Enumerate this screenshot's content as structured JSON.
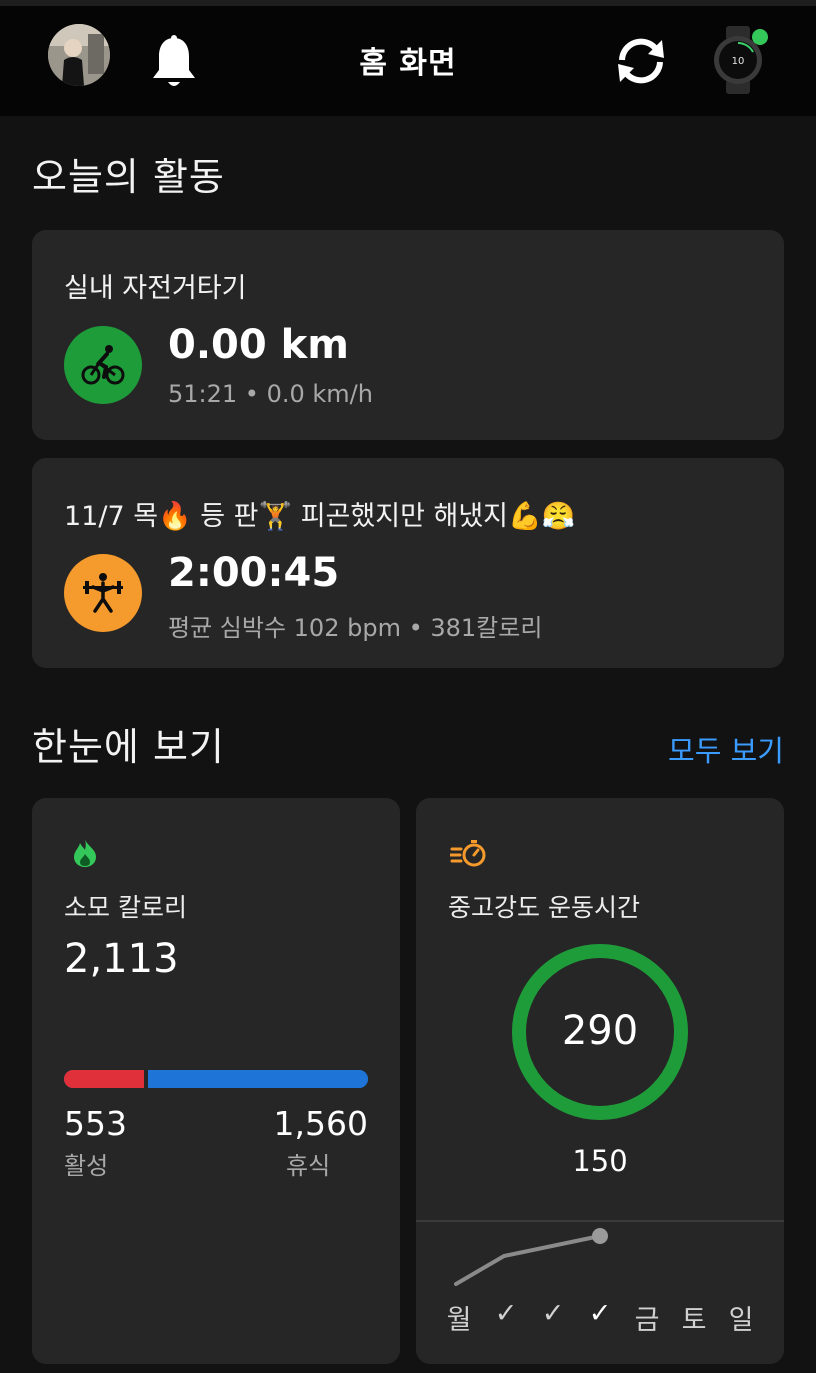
{
  "header": {
    "title": "홈 화면",
    "watch_connected_color": "#34c759"
  },
  "today": {
    "heading": "오늘의 활동",
    "activities": [
      {
        "title": "실내 자전거타기",
        "icon": "cycling-icon",
        "icon_color": "#1f9c3a",
        "main": "0.00 km",
        "sub": "51:21 • 0.0 km/h"
      },
      {
        "title": "11/7 목🔥 등 판🏋 피곤했지만 해냈지💪😤",
        "icon": "strength-training-icon",
        "icon_color": "#f59a2c",
        "main": "2:00:45",
        "sub": "평균 심박수 102 bpm • 381칼로리"
      }
    ]
  },
  "glance": {
    "heading": "한눈에 보기",
    "view_all": "모두 보기",
    "calories": {
      "label": "소모 칼로리",
      "value": "2,113",
      "active_value": "553",
      "active_label": "활성",
      "rest_value": "1,560",
      "rest_label": "휴식",
      "active_fraction": 0.262,
      "active_color": "#e0303a",
      "rest_color": "#1f74d8"
    },
    "intensity": {
      "label": "중고강도 운동시간",
      "value": "290",
      "goal": "150",
      "ring_color": "#1f9c3a",
      "icon_color": "#f59a2c",
      "days": [
        "월",
        "✓",
        "✓",
        "✓",
        "금",
        "토",
        "일"
      ],
      "completed_days": [
        1,
        2,
        3
      ]
    }
  }
}
